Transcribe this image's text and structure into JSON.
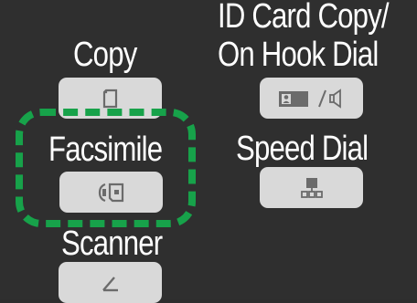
{
  "colors": {
    "background": "#2f2f2f",
    "button": "#d9d9d9",
    "icon": "#6b6b6b",
    "highlight": "#17a24a"
  },
  "menu": {
    "copy": {
      "label": "Copy",
      "icon": "copy-icon"
    },
    "facsimile": {
      "label": "Facsimile",
      "icon": "fax-icon",
      "highlighted": true
    },
    "scanner": {
      "label": "Scanner",
      "icon": "scanner-icon"
    },
    "id_card_copy": {
      "label_line1": "ID Card Copy/",
      "label_line2": "On Hook Dial",
      "icon": "id-card-on-hook-icon"
    },
    "speed_dial": {
      "label": "Speed Dial",
      "icon": "speed-dial-icon"
    }
  }
}
